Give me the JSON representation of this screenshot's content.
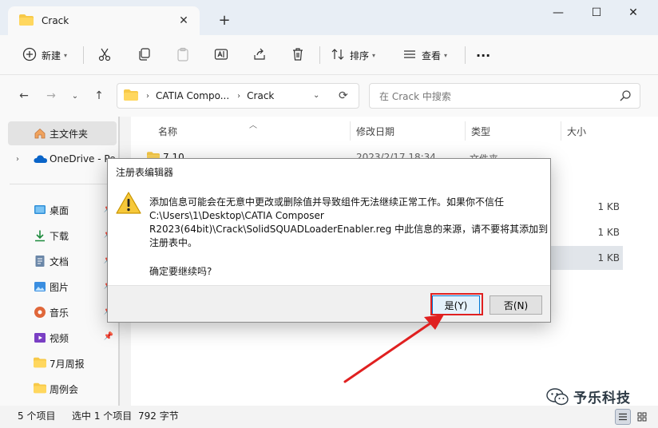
{
  "window": {
    "tab_title": "Crack",
    "tab_close_glyph": "✕",
    "new_tab_glyph": "+",
    "minimize_glyph": "—",
    "maximize_glyph": "☐",
    "close_glyph": "✕"
  },
  "toolbar": {
    "new_label": "新建",
    "sort_label": "排序",
    "view_label": "查看",
    "more_glyph": "···"
  },
  "address": {
    "crumbs": [
      "CATIA Compo...",
      "Crack"
    ],
    "search_placeholder": "在 Crack 中搜索"
  },
  "sidebar": {
    "home": "主文件夹",
    "onedrive": "OneDrive - Pe",
    "items": [
      {
        "label": "桌面",
        "icon": "desktop-icon"
      },
      {
        "label": "下载",
        "icon": "download-icon"
      },
      {
        "label": "文档",
        "icon": "document-icon"
      },
      {
        "label": "图片",
        "icon": "pictures-icon"
      },
      {
        "label": "音乐",
        "icon": "music-icon"
      },
      {
        "label": "视频",
        "icon": "video-icon"
      },
      {
        "label": "7月周报",
        "icon": "folder-icon"
      },
      {
        "label": "周例会",
        "icon": "folder-icon"
      }
    ]
  },
  "filelist": {
    "columns": {
      "name": "名称",
      "date": "修改日期",
      "type": "类型",
      "size": "大小"
    },
    "rows": [
      {
        "name": "7.10",
        "date": "2023/2/17 18:34",
        "type": "文件夹",
        "size": ""
      },
      {
        "name": "",
        "date": "",
        "type": "",
        "size": "1 KB"
      },
      {
        "name": "",
        "date": "",
        "type": "",
        "size": "1 KB"
      },
      {
        "name": "",
        "date": "",
        "type": "",
        "size": "1 KB"
      }
    ]
  },
  "status": {
    "count": "5 个项目",
    "selected": "选中 1 个项目",
    "size": "792 字节"
  },
  "watermark": {
    "text": "予乐科技"
  },
  "dialog": {
    "title": "注册表编辑器",
    "message_lines": [
      "添加信息可能会在无意中更改或删除值并导致组件无法继续正常工作。如果你不信任",
      "C:\\Users\\1\\Desktop\\CATIA Composer",
      "R2023(64bit)\\Crack\\SolidSQUADLoaderEnabler.reg 中此信息的来源，请不要将其添加到",
      "注册表中。"
    ],
    "confirm": "确定要继续吗?",
    "yes_label": "是(Y)",
    "no_label": "否(N)"
  },
  "colors": {
    "accent": "#0078d7",
    "highlight": "#e02020",
    "folder": "#f7c948"
  }
}
